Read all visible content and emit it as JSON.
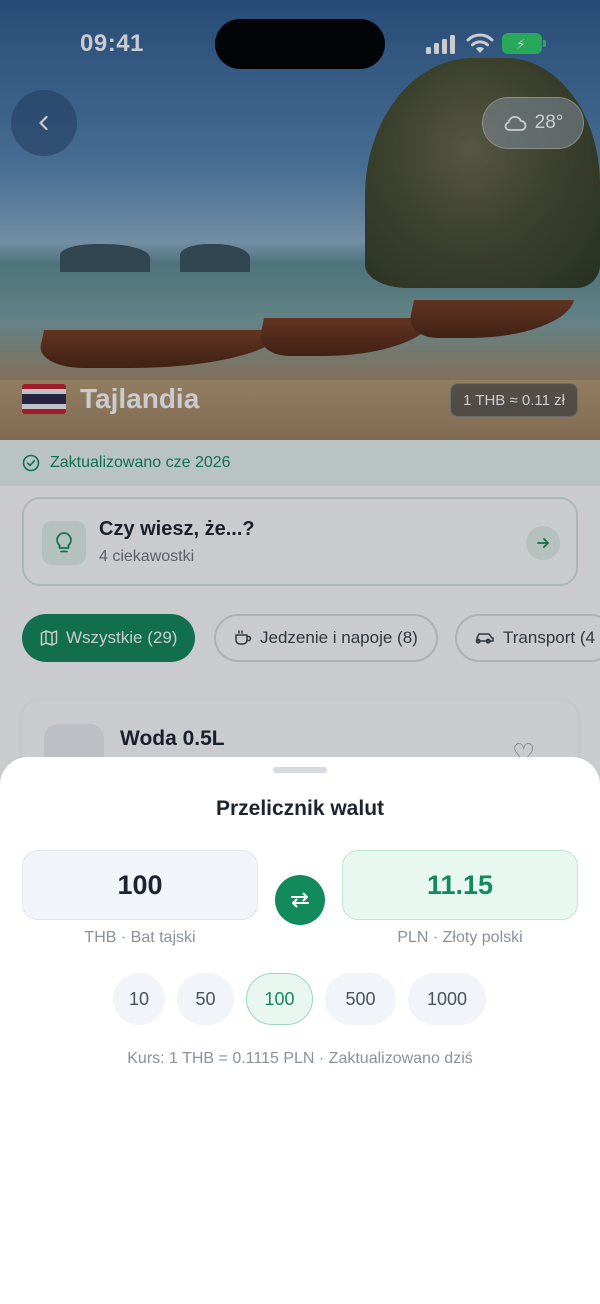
{
  "status_bar": {
    "time": "09:41"
  },
  "hero": {
    "country": "Tajlandia",
    "temperature": "28°",
    "rate": "1 THB ≈ 0.11 zł",
    "icons": {
      "back": "chevron-left-icon",
      "weather": "cloud-icon",
      "flag": "thailand-flag"
    }
  },
  "updated_banner": {
    "text": "Zaktualizowano cze 2026"
  },
  "fact_card": {
    "title": "Czy wiesz, że...?",
    "subtitle": "4 ciekawostki"
  },
  "categories": [
    {
      "label": "Wszystkie (29)",
      "icon": "map-icon",
      "active": true
    },
    {
      "label": "Jedzenie i napoje (8)",
      "icon": "cup-icon",
      "active": false
    },
    {
      "label": "Transport (4",
      "icon": "car-icon",
      "active": false
    }
  ],
  "first_item": {
    "name": "Woda 0.5L"
  },
  "converter": {
    "title": "Przelicznik walut",
    "from_value": "100",
    "from_label": "THB · Bat tajski",
    "to_value": "11.15",
    "to_label": "PLN · Złoty polski",
    "quick_amounts": [
      "10",
      "50",
      "100",
      "500",
      "1000"
    ],
    "selected_amount": "100",
    "rate_info": "Kurs: 1 THB = 0.1115 PLN · Zaktualizowano dziś"
  },
  "colors": {
    "accent": "#138a5c",
    "accent_light": "#e8f7ef",
    "battery": "#2fd36b"
  }
}
